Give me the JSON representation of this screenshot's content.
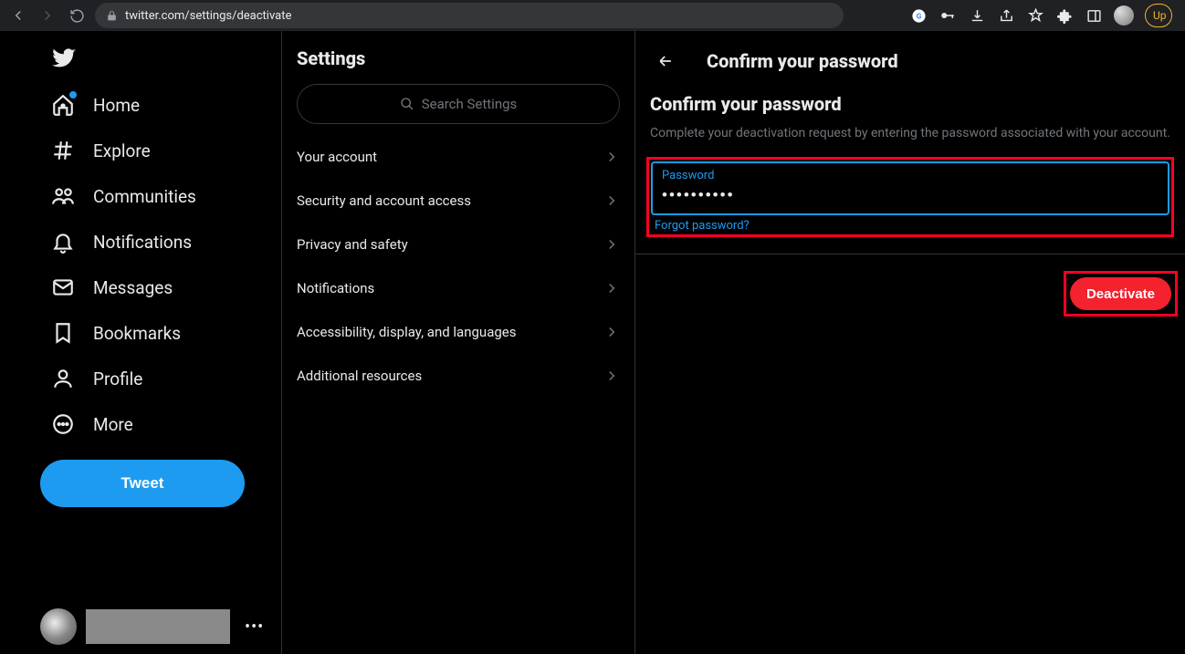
{
  "browser": {
    "url": "twitter.com/settings/deactivate",
    "upgrade_label": "Up"
  },
  "nav": {
    "items": [
      {
        "label": "Home"
      },
      {
        "label": "Explore"
      },
      {
        "label": "Communities"
      },
      {
        "label": "Notifications"
      },
      {
        "label": "Messages"
      },
      {
        "label": "Bookmarks"
      },
      {
        "label": "Profile"
      },
      {
        "label": "More"
      }
    ],
    "tweet_label": "Tweet"
  },
  "settings": {
    "title": "Settings",
    "search_placeholder": "Search Settings",
    "items": [
      {
        "label": "Your account"
      },
      {
        "label": "Security and account access"
      },
      {
        "label": "Privacy and safety"
      },
      {
        "label": "Notifications"
      },
      {
        "label": "Accessibility, display, and languages"
      },
      {
        "label": "Additional resources"
      }
    ]
  },
  "main": {
    "header_title": "Confirm your password",
    "section_title": "Confirm your password",
    "description": "Complete your deactivation request by entering the password associated with your account.",
    "password_label": "Password",
    "password_value": "••••••••••",
    "forgot_link": "Forgot password?",
    "deactivate_label": "Deactivate"
  }
}
